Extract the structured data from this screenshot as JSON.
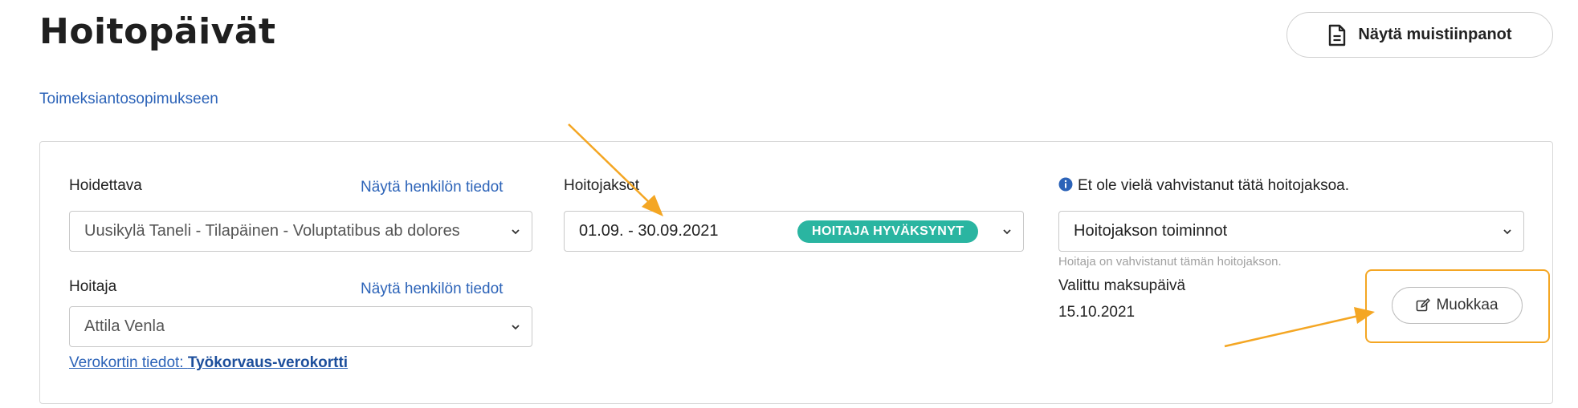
{
  "header": {
    "title": "Hoitopäivät",
    "notes_button": "Näytä muistiinpanot",
    "notes_icon": "document-icon",
    "back_link": "Toimeksiantosopimukseen"
  },
  "form": {
    "hoidettava": {
      "label": "Hoidettava",
      "link": "Näytä henkilön tiedot",
      "value": "Uusikylä Taneli - Tilapäinen - Voluptatibus ab dolores"
    },
    "hoitaja": {
      "label": "Hoitaja",
      "link": "Näytä henkilön tiedot",
      "value": "Attila Venla",
      "tax_card_prefix": "Verokortin tiedot: ",
      "tax_card_value": "Työkorvaus-verokortti"
    },
    "hoitojaksot": {
      "label": "Hoitojaksot",
      "value": "01.09. - 30.09.2021",
      "badge": "HOITAJA HYVÄKSYNYT",
      "badge_color": "#2ab5a1"
    },
    "actions": {
      "notice": "Et ole vielä vahvistanut tätä hoitojaksoa.",
      "notice_icon": "info-icon",
      "select_value": "Hoitojakson toiminnot",
      "hint": "Hoitaja on vahvistanut tämän hoitojakson.",
      "payday_label": "Valittu maksupäivä",
      "payday_value": "15.10.2021",
      "edit_button": "Muokkaa",
      "edit_icon": "edit-icon"
    }
  },
  "annotation": {
    "color": "#f4a623"
  }
}
